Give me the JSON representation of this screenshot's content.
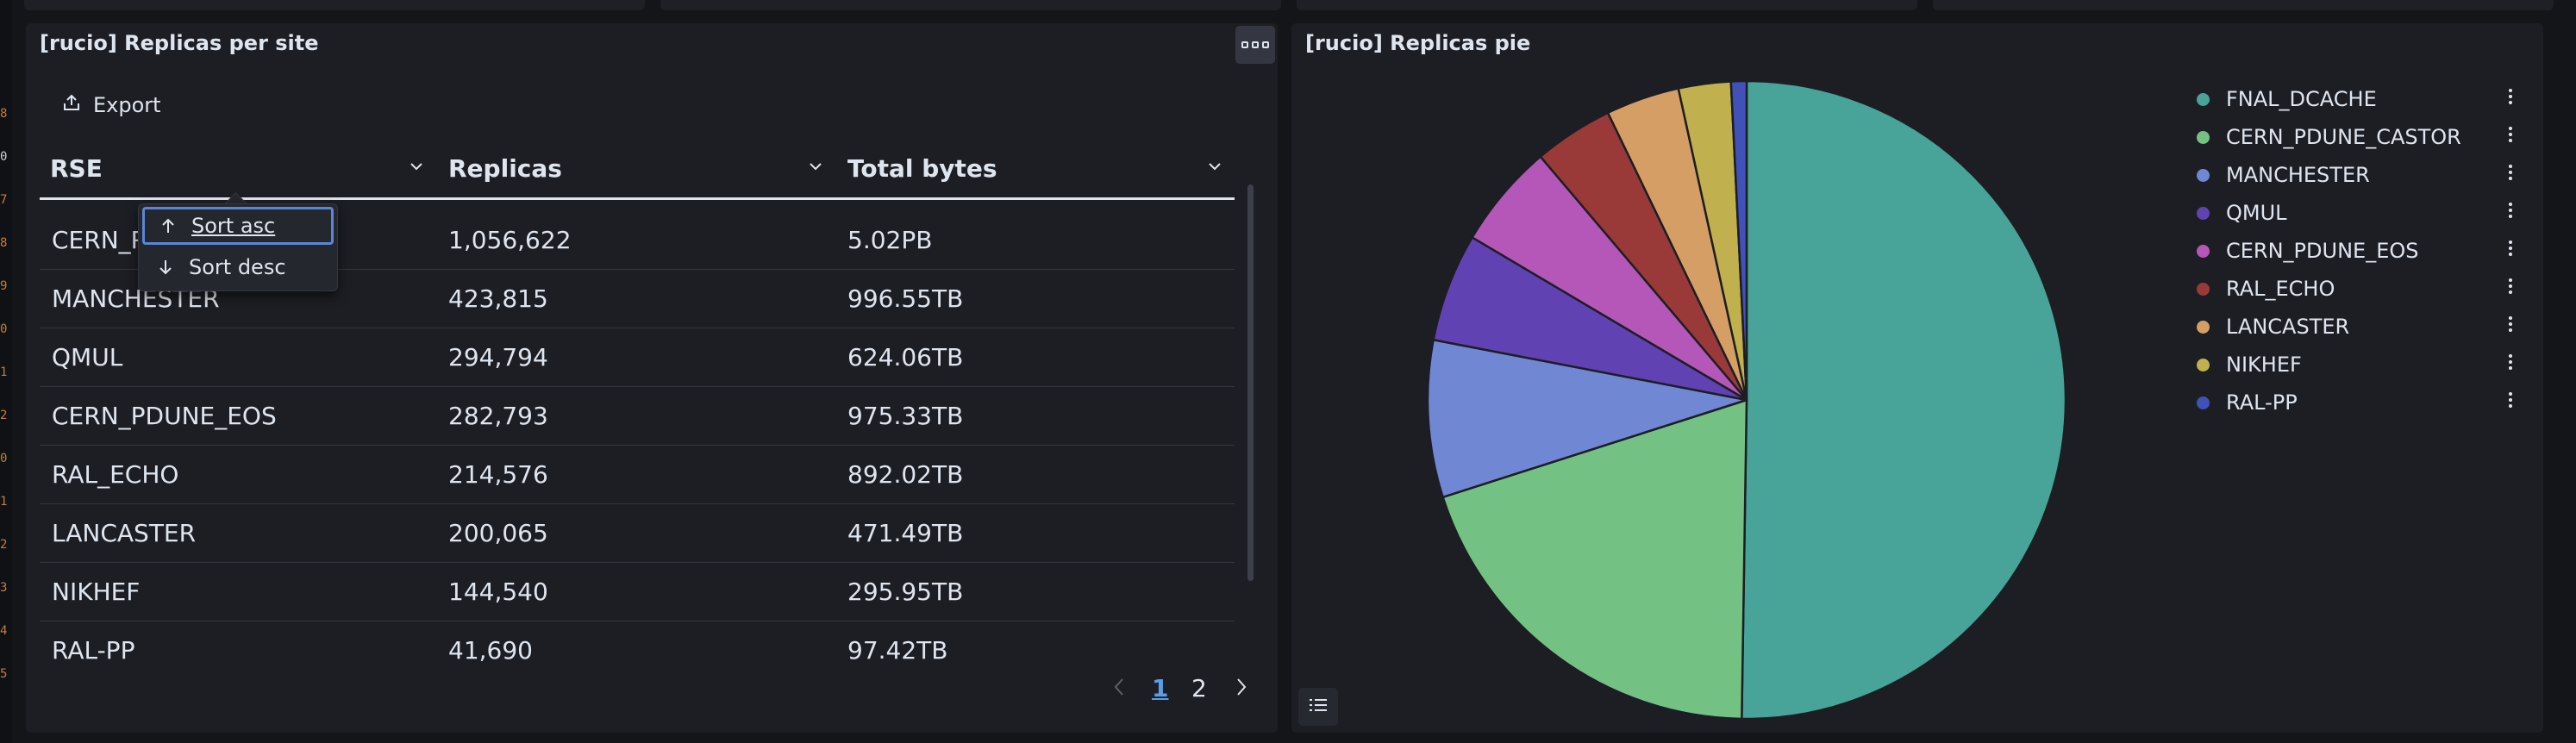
{
  "gutter_digits": [
    "8",
    "0",
    "7",
    "8",
    "9",
    "0",
    "1",
    "2",
    "0",
    "1",
    "2",
    "3",
    "4",
    "5"
  ],
  "table_panel": {
    "title": "[rucio] Replicas per site",
    "export_label": "Export",
    "columns": [
      "RSE",
      "Replicas",
      "Total bytes"
    ],
    "rows": [
      {
        "rse": "CERN_PDUNE_CASTOR",
        "replicas": "1,056,622",
        "bytes": "5.02PB"
      },
      {
        "rse": "MANCHESTER",
        "replicas": "423,815",
        "bytes": "996.55TB"
      },
      {
        "rse": "QMUL",
        "replicas": "294,794",
        "bytes": "624.06TB"
      },
      {
        "rse": "CERN_PDUNE_EOS",
        "replicas": "282,793",
        "bytes": "975.33TB"
      },
      {
        "rse": "RAL_ECHO",
        "replicas": "214,576",
        "bytes": "892.02TB"
      },
      {
        "rse": "LANCASTER",
        "replicas": "200,065",
        "bytes": "471.49TB"
      },
      {
        "rse": "NIKHEF",
        "replicas": "144,540",
        "bytes": "295.95TB"
      },
      {
        "rse": "RAL-PP",
        "replicas": "41,690",
        "bytes": "97.42TB"
      }
    ],
    "sort_menu": {
      "asc": "Sort asc",
      "desc": "Sort desc"
    },
    "pagination": {
      "pages": [
        "1",
        "2"
      ],
      "current": "1"
    }
  },
  "pie_panel": {
    "title": "[rucio] Replicas pie"
  },
  "chart_data": {
    "type": "pie",
    "title": "[rucio] Replicas pie",
    "legend_position": "right",
    "slices": [
      {
        "label": "FNAL_DCACHE",
        "value": 51.2,
        "color": "#48a398"
      },
      {
        "label": "CERN_PDUNE_CASTOR",
        "value": 20.2,
        "color": "#74c283"
      },
      {
        "label": "MANCHESTER",
        "value": 8.1,
        "color": "#7087d4"
      },
      {
        "label": "QMUL",
        "value": 5.6,
        "color": "#6142b2"
      },
      {
        "label": "CERN_PDUNE_EOS",
        "value": 5.4,
        "color": "#b557b8"
      },
      {
        "label": "RAL_ECHO",
        "value": 4.1,
        "color": "#9a3a38"
      },
      {
        "label": "LANCASTER",
        "value": 3.8,
        "color": "#d49e65"
      },
      {
        "label": "NIKHEF",
        "value": 2.7,
        "color": "#c1b04e"
      },
      {
        "label": "RAL-PP",
        "value": 0.8,
        "color": "#4051b8"
      }
    ]
  },
  "colors": {
    "background": "#141519",
    "panel": "#1d1e24",
    "text": "#dfe5ef",
    "row_divider": "#343741",
    "focus": "#5a86d6",
    "link": "#5a9ee8"
  },
  "icons": {
    "export": "export-icon",
    "panel_options": "panel-options-icon",
    "sort_asc": "arrow-up-icon",
    "sort_desc": "arrow-down-icon",
    "column_menu": "chevron-down-icon",
    "legend_item_options": "kebab-icon",
    "legend_toggle": "list-icon"
  }
}
